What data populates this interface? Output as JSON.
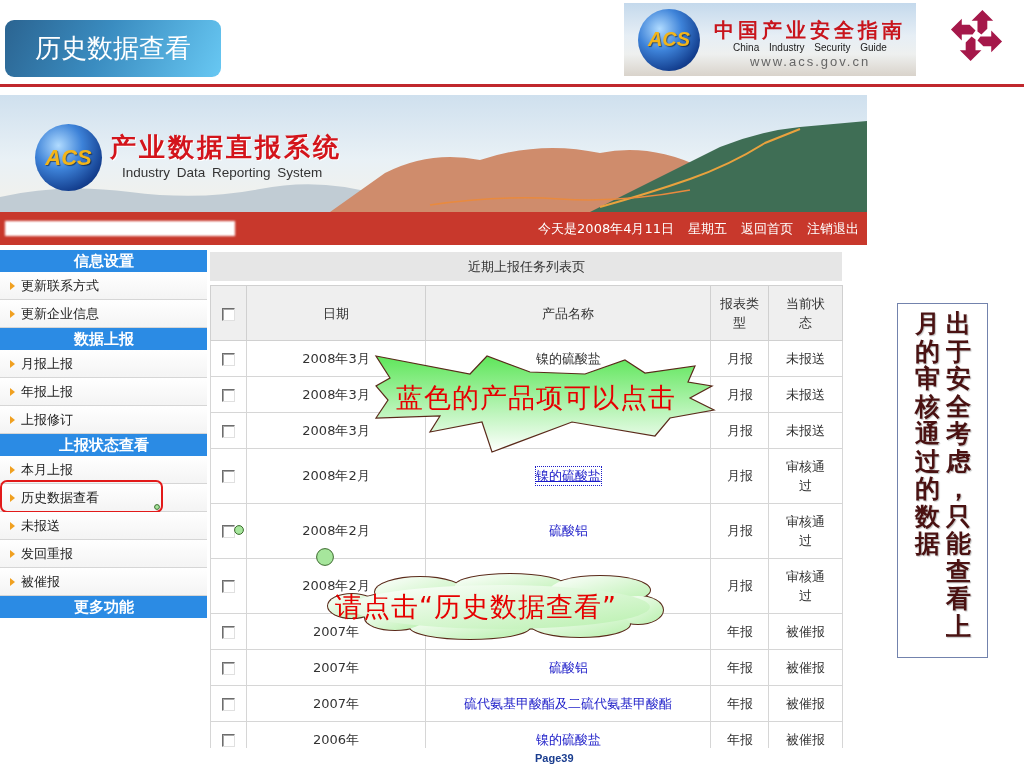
{
  "slide_title": "历史数据查看",
  "brand": {
    "badge": "ACS",
    "name": "中国产业安全指南",
    "subtitle": "China Industry Security Guide",
    "url": "www.acs.gov.cn"
  },
  "system": {
    "badge": "ACS",
    "title": "产业数据直报系统",
    "subtitle": "Industry Data Reporting System",
    "date": "今天是2008年4月11日",
    "weekday": "星期五",
    "links": [
      "返回首页",
      "注销退出"
    ]
  },
  "sidebar": [
    {
      "title": "信息设置",
      "items": [
        {
          "label": "更新联系方式",
          "highlighted": false
        },
        {
          "label": "更新企业信息",
          "highlighted": false
        }
      ]
    },
    {
      "title": "数据上报",
      "items": [
        {
          "label": "月报上报",
          "highlighted": false
        },
        {
          "label": "年报上报",
          "highlighted": false
        },
        {
          "label": "上报修订",
          "highlighted": false
        }
      ]
    },
    {
      "title": "上报状态查看",
      "items": [
        {
          "label": "本月上报",
          "highlighted": false
        },
        {
          "label": "历史数据查看",
          "highlighted": true
        },
        {
          "label": "未报送",
          "highlighted": false
        },
        {
          "label": "发回重报",
          "highlighted": false
        },
        {
          "label": "被催报",
          "highlighted": false
        }
      ]
    },
    {
      "title": "更多功能"
    }
  ],
  "table": {
    "caption": "近期上报任务列表页",
    "select_all_checked": false,
    "columns": [
      "日期",
      "产品名称",
      "报表类型",
      "当前状态"
    ],
    "rows": [
      {
        "checked": false,
        "date": "2008年3月",
        "product": {
          "text": "镍的硫酸盐",
          "link": false,
          "focused": false
        },
        "type": "月报",
        "status": "未报送"
      },
      {
        "checked": false,
        "date": "2008年3月",
        "type": "月报",
        "status": "未报送"
      },
      {
        "checked": false,
        "date": "2008年3月",
        "type": "月报",
        "status": "未报送"
      },
      {
        "checked": false,
        "date": "2008年2月",
        "product": {
          "text": "镍的硫酸盐",
          "link": true,
          "focused": true
        },
        "type": "月报",
        "status": "审核通过"
      },
      {
        "checked": false,
        "date": "2008年2月",
        "product": {
          "text": "硫酸铝",
          "link": true,
          "focused": false
        },
        "type": "月报",
        "status": "审核通过"
      },
      {
        "checked": false,
        "date": "2008年2月",
        "type": "月报",
        "status": "审核通过"
      },
      {
        "checked": false,
        "date": "2007年",
        "type": "年报",
        "status": "被催报"
      },
      {
        "checked": false,
        "date": "2007年",
        "product": {
          "text": "硫酸铝",
          "link": true,
          "focused": false
        },
        "type": "年报",
        "status": "被催报"
      },
      {
        "checked": false,
        "date": "2007年",
        "product": {
          "text": "硫代氨基甲酸酯及二硫代氨基甲酸酯",
          "link": true,
          "focused": false
        },
        "type": "年报",
        "status": "被催报"
      },
      {
        "checked": false,
        "date": "2006年",
        "product": {
          "text": "镍的硫酸盐",
          "link": true,
          "focused": false
        },
        "type": "年报",
        "status": "被催报"
      }
    ]
  },
  "callouts": [
    {
      "kind": "starburst",
      "text": "蓝色的产品项可以点击"
    },
    {
      "kind": "cloud",
      "text": "请点击“历史数据查看”"
    }
  ],
  "note": {
    "text": "出于安全考虑，只能查看上月的审核通过的数据"
  },
  "page": "Page39"
}
